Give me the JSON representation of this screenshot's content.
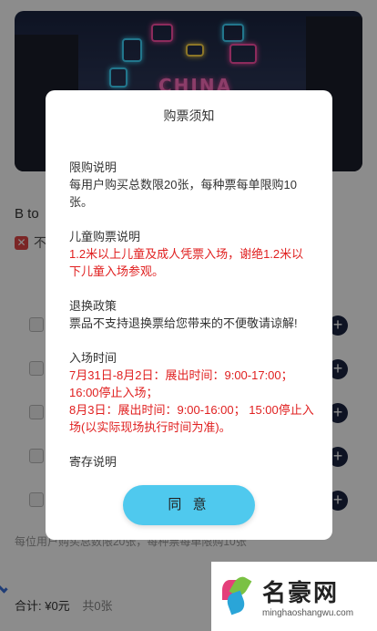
{
  "banner": {
    "sign_text": "CHINA"
  },
  "page": {
    "title": "B to",
    "warning": "不",
    "limit_note": "每位用户购买总数限20张，每种票每单限购10张",
    "total_label": "合计: ¥0元",
    "count_label": "共0张",
    "plus_symbol": "+"
  },
  "watermark": {
    "name": "名豪网",
    "url": "minghaoshangwu.com"
  },
  "modal": {
    "title": "购票须知",
    "sections": [
      {
        "heading": "限购说明",
        "text": "每用户购买总数限20张，每种票每单限购10张。",
        "style": "normal"
      },
      {
        "heading": "儿童购票说明",
        "text": "1.2米以上儿童及成人凭票入场，谢绝1.2米以下儿童入场参观。",
        "style": "red"
      },
      {
        "heading": "退换政策",
        "text": "票品不支持退换票给您带来的不便敬请谅解!",
        "style": "normal"
      },
      {
        "heading": "入场时间",
        "text": "7月31日-8月2日：展出时间：9:00-17:00；16:00停止入场；",
        "text2": "8月3日：展出时间：9:00-16:00； 15:00停止入场(以实际现场执行时间为准)。",
        "style": "red"
      },
      {
        "heading": "寄存说明"
      }
    ],
    "agree_label": "同 意"
  },
  "colors": {
    "accent": "#4fc9ee",
    "red_text": "#e02020",
    "dark_navy": "#1a2340"
  }
}
